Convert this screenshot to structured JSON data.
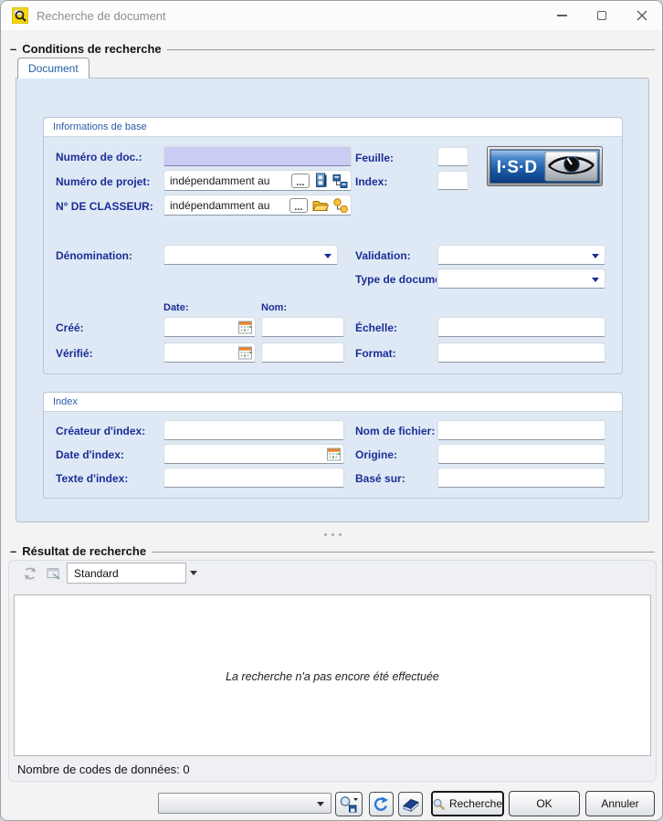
{
  "window": {
    "title": "Recherche de document"
  },
  "conditions": {
    "dash": "–",
    "label": "Conditions de recherche",
    "tab": "Document"
  },
  "base": {
    "header": "Informations de base",
    "doc_no": "Numéro de doc.:",
    "project_no": "Numéro de projet:",
    "project_value": "indépendamment au",
    "classeur": "N° DE CLASSEUR:",
    "classeur_value": "indépendamment au",
    "browse": "...",
    "feuille": "Feuille:",
    "index": "Index:",
    "denomination": "Dénomination:",
    "validation": "Validation:",
    "type_doc": "Type de docume",
    "date_h": "Date:",
    "nom_h": "Nom:",
    "cree": "Créé:",
    "verifie": "Vérifié:",
    "echelle": "Échelle:",
    "format": "Format:"
  },
  "index": {
    "header": "Index",
    "createur": "Créateur d'index:",
    "date": "Date d'index:",
    "texte": "Texte d'index:",
    "fichier": "Nom de fichier:",
    "origine": "Origine:",
    "base_sur": "Basé sur:"
  },
  "results": {
    "dash": "–",
    "label": "Résultat de recherche",
    "view": "Standard",
    "empty": "La recherche n'a pas encore été effectuée",
    "count": "Nombre de codes de données: 0"
  },
  "footer": {
    "search": "Recherche",
    "ok": "OK",
    "cancel": "Annuler"
  },
  "logo": {
    "text": "I·S·D"
  },
  "icons": {
    "app": "search-document",
    "minimize": "minimize",
    "maximize": "maximize",
    "close": "close",
    "browse": "ellipsis",
    "project_source": "database-cabinet",
    "project_structure": "hierarchy-squares",
    "classeur_folder": "folder-open",
    "classeur_structure": "hierarchy-circles",
    "calendar": "calendar-picker",
    "refresh_disabled": "refresh",
    "result_view": "window-view",
    "search_save": "search-save",
    "refresh": "refresh",
    "clear": "eraser",
    "search": "magnifier"
  },
  "colors": {
    "label": "#1c2d96",
    "panel": "#dee9f5",
    "doc_field": "#cbccf3",
    "tab_text": "#1f5fa5",
    "section_text": "#2a5ca8",
    "logo_blue": "#1c5ca8"
  }
}
